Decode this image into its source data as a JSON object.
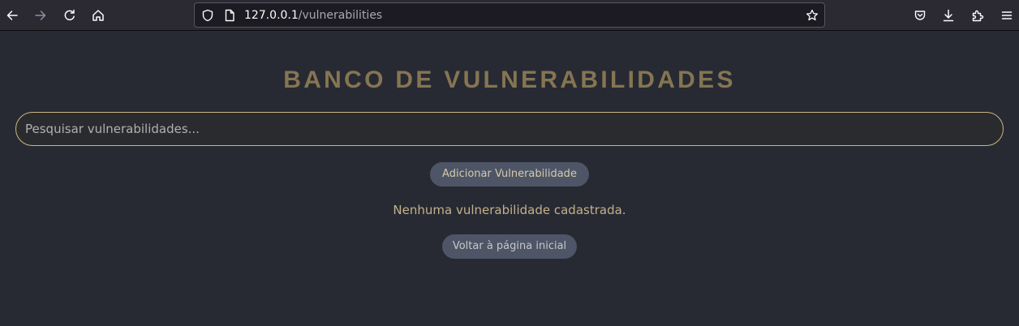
{
  "browser": {
    "url_host": "127.0.0.1",
    "url_path": "/vulnerabilities",
    "icons": {
      "back": "back-arrow-icon",
      "forward": "forward-arrow-icon",
      "reload": "reload-icon",
      "home": "home-icon",
      "tracking": "shield-icon",
      "page": "page-icon",
      "bookmark": "star-icon",
      "pocket": "pocket-icon",
      "downloads": "download-icon",
      "extensions": "puzzle-icon",
      "menu": "hamburger-menu-icon"
    }
  },
  "page": {
    "title": "BANCO DE VULNERABILIDADES",
    "search_placeholder": "Pesquisar vulnerabilidades...",
    "add_button": "Adicionar Vulnerabilidade",
    "empty_message": "Nenhuma vulnerabilidade cadastrada.",
    "back_button": "Voltar à página inicial"
  },
  "colors": {
    "background": "#272a33",
    "title": "#857552",
    "accent_border": "#cbb582",
    "button_bg": "#4d5567",
    "message": "#c3b18c"
  }
}
